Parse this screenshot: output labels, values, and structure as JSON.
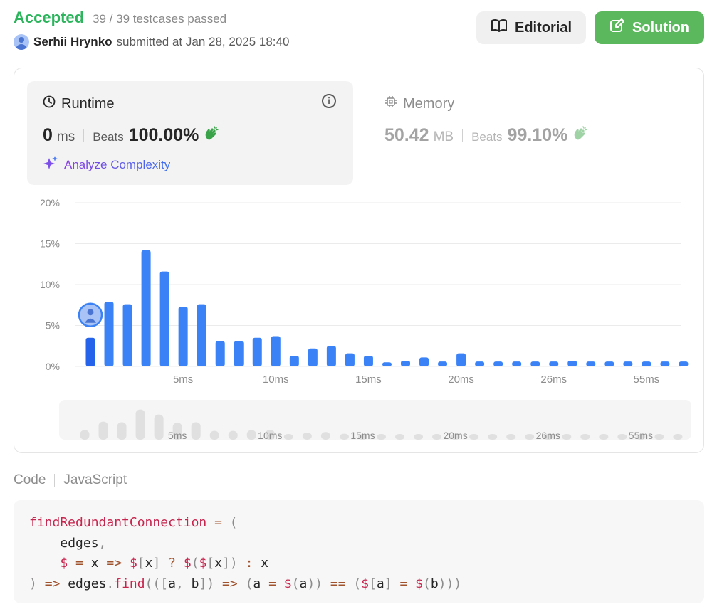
{
  "submission": {
    "status": "Accepted",
    "testcases": "39 / 39 testcases passed",
    "user": "Serhii Hrynko",
    "submitted_at": "submitted at Jan 28, 2025 18:40"
  },
  "actions": {
    "editorial_label": "Editorial",
    "solution_label": "Solution"
  },
  "runtime": {
    "title": "Runtime",
    "value": "0",
    "unit": "ms",
    "beats_label": "Beats",
    "beats": "100.00%",
    "analyze_label": "Analyze Complexity"
  },
  "memory": {
    "title": "Memory",
    "value": "50.42",
    "unit": "MB",
    "beats_label": "Beats",
    "beats": "99.10%"
  },
  "chart_data": {
    "type": "bar",
    "ylabel": "",
    "xlabel": "",
    "ylim": [
      0,
      20
    ],
    "yticks": [
      "0%",
      "5%",
      "10%",
      "15%",
      "20%"
    ],
    "x_tick_labels": [
      "5ms",
      "10ms",
      "15ms",
      "20ms",
      "26ms",
      "55ms"
    ],
    "values": [
      3.5,
      7.9,
      7.6,
      14.2,
      11.6,
      7.3,
      7.6,
      3.1,
      3.1,
      3.5,
      3.7,
      1.3,
      2.2,
      2.5,
      1.6,
      1.3,
      0.5,
      0.7,
      1.1,
      0.6,
      1.6,
      0.6,
      0.6,
      0.6,
      0.6,
      0.6,
      0.7,
      0.6,
      0.6,
      0.6,
      0.6,
      0.6,
      0.6
    ],
    "user_bar_index": 0,
    "colors": {
      "bar": "#3b82f6",
      "user_bar": "#2563eb",
      "mini_bar": "#e0e0e0",
      "grid": "#ebebeb"
    }
  },
  "code": {
    "label": "Code",
    "language": "JavaScript",
    "lines": [
      "findRedundantConnection = (",
      "    edges,",
      "    $ = x => $[x] ? $($[x]) : x",
      ") => edges.find(([a, b]) => (a = $(a)) == ($[a] = $(b)))"
    ]
  }
}
